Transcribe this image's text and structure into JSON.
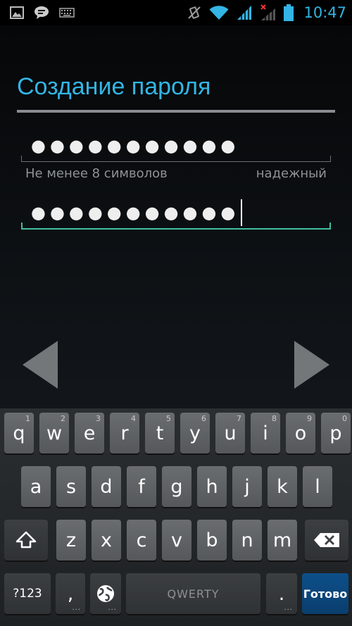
{
  "status_bar": {
    "time": "10:47",
    "left_icons": [
      "gallery-icon",
      "chat-icon",
      "keyboard-icon"
    ],
    "right_icons": [
      "vibrate-off-icon",
      "wifi-icon",
      "signal-icon",
      "signal-no-service-icon",
      "battery-icon"
    ],
    "accent": "#33b5e5"
  },
  "header": {
    "title": "Создание пароля"
  },
  "form": {
    "password_dots": "●●●●●●●●●●●",
    "confirm_dots": "●●●●●●●●●●●",
    "hint_min_length": "Не менее 8 символов",
    "strength_label": "надежный",
    "focus_color": "#3fbfa0"
  },
  "navigation": {
    "prev_icon": "triangle-left-icon",
    "next_icon": "triangle-right-icon"
  },
  "keyboard": {
    "row1": [
      {
        "label": "q",
        "num": "1"
      },
      {
        "label": "w",
        "num": "2"
      },
      {
        "label": "e",
        "num": "3"
      },
      {
        "label": "r",
        "num": "4"
      },
      {
        "label": "t",
        "num": "5"
      },
      {
        "label": "y",
        "num": "6"
      },
      {
        "label": "u",
        "num": "7"
      },
      {
        "label": "i",
        "num": "8"
      },
      {
        "label": "o",
        "num": "9"
      },
      {
        "label": "p",
        "num": "0"
      }
    ],
    "row2": [
      "a",
      "s",
      "d",
      "f",
      "g",
      "h",
      "j",
      "k",
      "l"
    ],
    "row3": [
      "z",
      "x",
      "c",
      "v",
      "b",
      "n",
      "m"
    ],
    "symbols_label": "?123",
    "comma_label": ",",
    "space_label": "QWERTY",
    "period_label": ".",
    "done_label": "Готово",
    "done_color": "#0d4f8a"
  }
}
